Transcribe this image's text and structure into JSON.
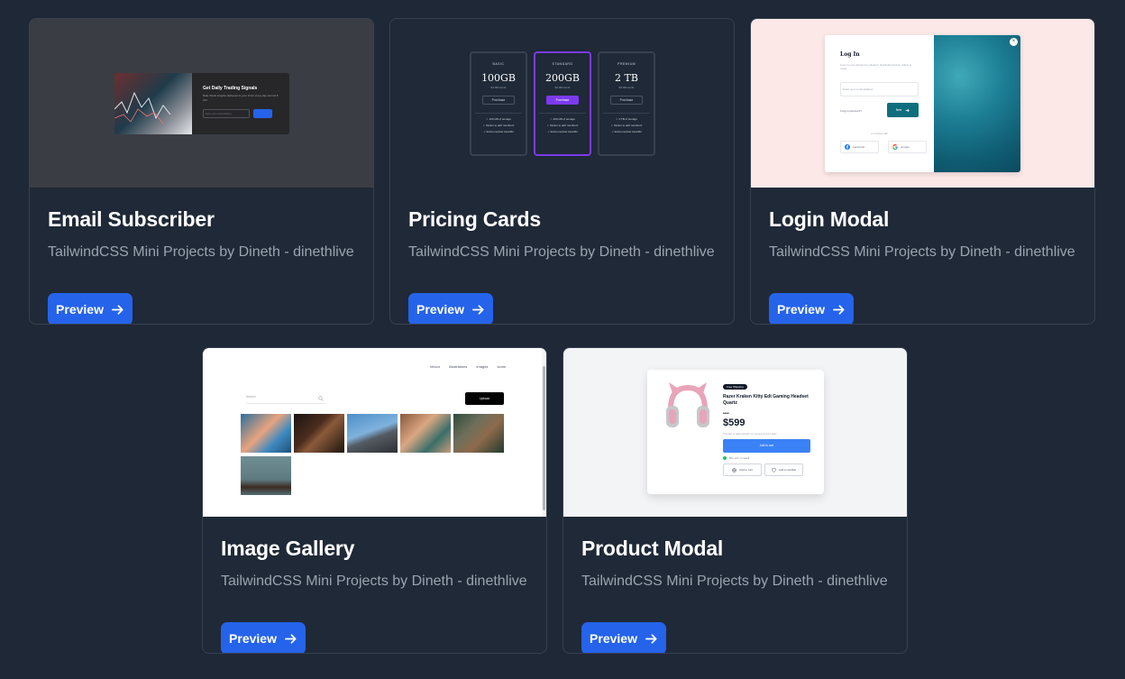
{
  "common": {
    "subtitle": "TailwindCSS Mini Projects by Dineth - dinethlive",
    "preview_label": "Preview"
  },
  "cards": [
    {
      "title": "Email Subscriber",
      "thumb": {
        "heading": "Get Daily Trading Signals",
        "text": "Daily Stock insights delivered to your inbox every day around 9 AM",
        "input_placeholder": "Enter your email address"
      }
    },
    {
      "title": "Pricing Cards",
      "thumb": {
        "plans": [
          {
            "tier": "BASIC",
            "size": "100GB",
            "price": "$1.99/month",
            "button": "Purchase"
          },
          {
            "tier": "STANDARD",
            "size": "200GB",
            "price": "$2.99/month",
            "button": "Purchase"
          },
          {
            "tier": "PREMIUM",
            "size": "2 TB",
            "price": "$4.99/month",
            "button": "Purchase"
          }
        ],
        "features_by_plan": [
          [
            "100 GB of storage",
            "Option to add members",
            "Extra member benefits"
          ],
          [
            "200 GB of storage",
            "Option to add members",
            "Extra member benefits"
          ],
          [
            "2 TB of storage",
            "Option to add members",
            "Extra member benefits"
          ]
        ]
      }
    },
    {
      "title": "Login Modal",
      "thumb": {
        "heading": "Log In",
        "subtext": "Log in to your account to upload or download pictures, videos or music.",
        "input_placeholder": "Enter your email address",
        "forgot": "Forgot password?",
        "next": "Next",
        "or": "or continue with",
        "facebook": "Facebook",
        "google": "Google"
      }
    },
    {
      "title": "Image Gallery",
      "thumb": {
        "nav": [
          "Vector",
          "Illustrations",
          "Images",
          "Icons"
        ],
        "search_placeholder": "Search",
        "upload": "Upload"
      }
    },
    {
      "title": "Product Modal",
      "thumb": {
        "tag": "Free Shipping",
        "name": "Razer Kraken Kitty Edt Gaming Headset Quartz",
        "old_price": "$799",
        "price": "$599",
        "note": "This offer is valid until April 3 or as long as stock lasts!",
        "cart": "Add to cart",
        "stock": "50+ pcs. in stock",
        "add_cart": "Add to cart",
        "wishlist": "Add to wishlist"
      }
    }
  ]
}
